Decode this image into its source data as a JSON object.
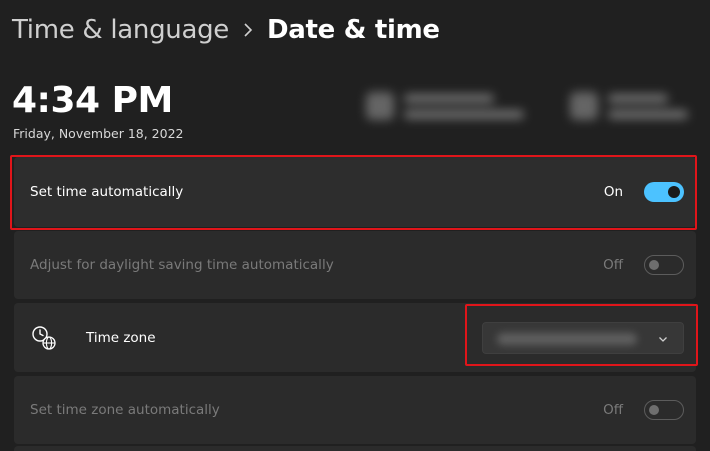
{
  "breadcrumb": {
    "parent": "Time & language",
    "current": "Date & time"
  },
  "clock": {
    "time": "4:34 PM",
    "date": "Friday, November 18, 2022"
  },
  "settings": {
    "set_time_auto": {
      "label": "Set time automatically",
      "state": "On",
      "enabled": true
    },
    "daylight_saving": {
      "label": "Adjust for daylight saving time automatically",
      "state": "Off",
      "enabled": false
    },
    "time_zone": {
      "label": "Time zone",
      "value": ""
    },
    "set_timezone_auto": {
      "label": "Set time zone automatically",
      "state": "Off",
      "enabled": false
    }
  },
  "colors": {
    "background": "#202020",
    "card": "#2b2b2b",
    "accent": "#4cc2ff",
    "highlight_border": "#e0151a",
    "disabled_text": "#7a7a7a"
  },
  "icons": {
    "breadcrumb_separator": "chevron-right-icon",
    "time_zone": "clock-globe-icon",
    "dropdown": "chevron-down-icon"
  }
}
